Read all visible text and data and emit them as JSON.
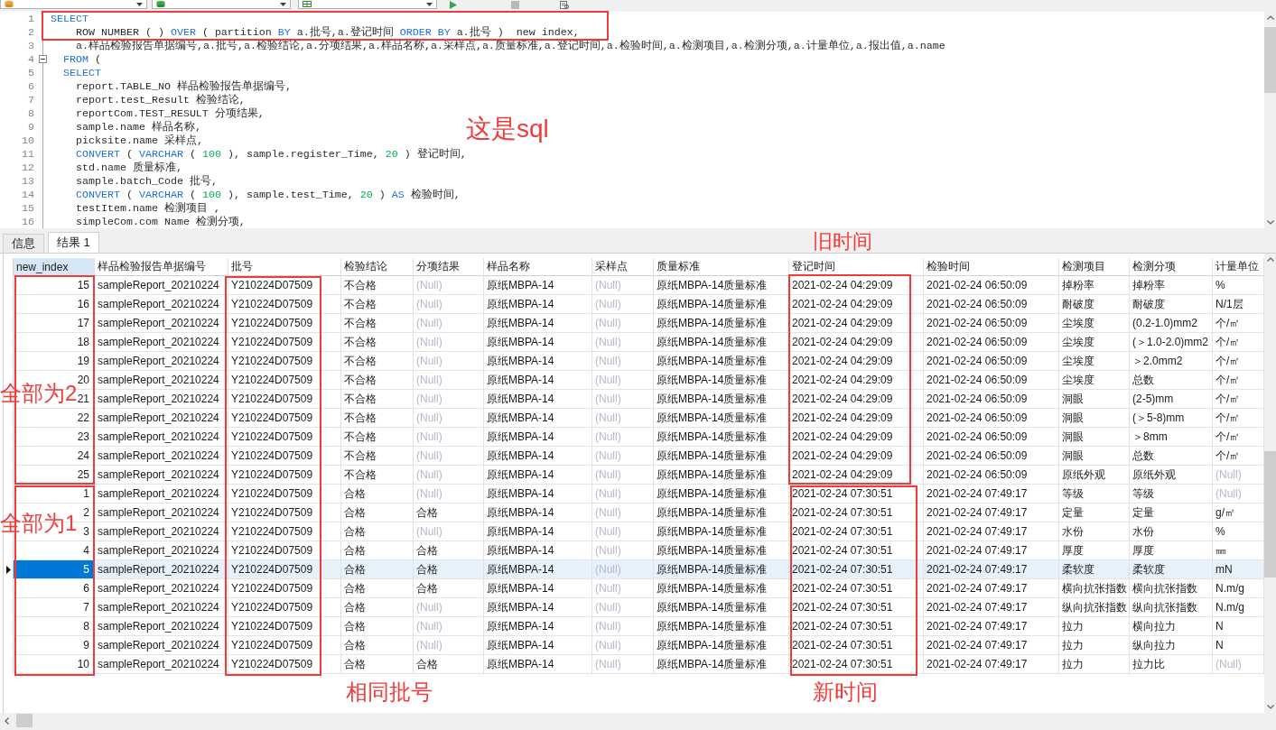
{
  "editor": {
    "lines": [
      {
        "number": "1",
        "fold_marker": false,
        "code": [
          {
            "kind": "keyword",
            "text": "SELECT"
          }
        ]
      },
      {
        "number": "2",
        "fold_marker": false,
        "code": [
          {
            "kind": "plain",
            "text": "    ROW NUMBER ( ) "
          },
          {
            "kind": "keyword",
            "text": "OVER"
          },
          {
            "kind": "plain",
            "text": " ( partition "
          },
          {
            "kind": "keyword",
            "text": "BY"
          },
          {
            "kind": "plain",
            "text": " a.批号,a.登记时间 "
          },
          {
            "kind": "keyword",
            "text": "ORDER BY"
          },
          {
            "kind": "plain",
            "text": " a.批号 )  new index,"
          }
        ]
      },
      {
        "number": "3",
        "fold_marker": false,
        "code": [
          {
            "kind": "plain",
            "text": "    a.样品检验报告单据编号,a.批号,a.检验结论,a.分项结果,a.样品名称,a.采样点,a.质量标准,a.登记时间,a.检验时间,a.检测项目,a.检测分项,a.计量单位,a.报出值,a.name"
          }
        ]
      },
      {
        "number": "4",
        "fold_marker": true,
        "code": [
          {
            "kind": "keyword",
            "text": "  FROM"
          },
          {
            "kind": "plain",
            "text": " ("
          }
        ]
      },
      {
        "number": "5",
        "fold_marker": false,
        "code": [
          {
            "kind": "keyword",
            "text": "  SELECT"
          }
        ]
      },
      {
        "number": "6",
        "fold_marker": false,
        "code": [
          {
            "kind": "plain",
            "text": "    report.TABLE_NO 样品检验报告单据编号,"
          }
        ]
      },
      {
        "number": "7",
        "fold_marker": false,
        "code": [
          {
            "kind": "plain",
            "text": "    report.test_Result 检验结论,"
          }
        ]
      },
      {
        "number": "8",
        "fold_marker": false,
        "code": [
          {
            "kind": "plain",
            "text": "    reportCom.TEST_RESULT 分项结果,"
          }
        ]
      },
      {
        "number": "9",
        "fold_marker": false,
        "code": [
          {
            "kind": "plain",
            "text": "    sample.name 样品名称,"
          }
        ]
      },
      {
        "number": "10",
        "fold_marker": false,
        "code": [
          {
            "kind": "plain",
            "text": "    picksite.name 采样点,"
          }
        ]
      },
      {
        "number": "11",
        "fold_marker": false,
        "code": [
          {
            "kind": "keyword",
            "text": "    CONVERT"
          },
          {
            "kind": "plain",
            "text": " ( "
          },
          {
            "kind": "keyword",
            "text": "VARCHAR"
          },
          {
            "kind": "plain",
            "text": " ( "
          },
          {
            "kind": "number",
            "text": "100"
          },
          {
            "kind": "plain",
            "text": " ), sample.register_Time, "
          },
          {
            "kind": "number",
            "text": "20"
          },
          {
            "kind": "plain",
            "text": " ) 登记时间,"
          }
        ]
      },
      {
        "number": "12",
        "fold_marker": false,
        "code": [
          {
            "kind": "plain",
            "text": "    std.name 质量标准,"
          }
        ]
      },
      {
        "number": "13",
        "fold_marker": false,
        "code": [
          {
            "kind": "plain",
            "text": "    sample.batch_Code 批号,"
          }
        ]
      },
      {
        "number": "14",
        "fold_marker": false,
        "code": [
          {
            "kind": "keyword",
            "text": "    CONVERT"
          },
          {
            "kind": "plain",
            "text": " ( "
          },
          {
            "kind": "keyword",
            "text": "VARCHAR"
          },
          {
            "kind": "plain",
            "text": " ( "
          },
          {
            "kind": "number",
            "text": "100"
          },
          {
            "kind": "plain",
            "text": " ), sample.test_Time, "
          },
          {
            "kind": "number",
            "text": "20"
          },
          {
            "kind": "plain",
            "text": " ) "
          },
          {
            "kind": "keyword",
            "text": "AS"
          },
          {
            "kind": "plain",
            "text": " 检验时间,"
          }
        ]
      },
      {
        "number": "15",
        "fold_marker": false,
        "code": [
          {
            "kind": "plain",
            "text": "    testItem.name 检测项目 ,"
          }
        ]
      },
      {
        "number": "16",
        "fold_marker": false,
        "code": [
          {
            "kind": "plain",
            "text": "    simpleCom.com Name 检测分项,"
          }
        ]
      }
    ],
    "annotations": [
      {
        "kind": "frame"
      },
      {
        "kind": "note",
        "text": "这是sql"
      }
    ]
  },
  "results": {
    "tabs": [
      {
        "label": "信息",
        "selected": false
      },
      {
        "label": "结果 1",
        "selected": true
      }
    ],
    "table": {
      "columns": [
        {
          "label": "new_index",
          "selected": true
        },
        {
          "label": "样品检验报告单据编号",
          "selected": false
        },
        {
          "label": "批号",
          "selected": false
        },
        {
          "label": "检验结论",
          "selected": false
        },
        {
          "label": "分项结果",
          "selected": false
        },
        {
          "label": "样品名称",
          "selected": false
        },
        {
          "label": "采样点",
          "selected": false
        },
        {
          "label": "质量标准",
          "selected": false
        },
        {
          "label": "登记时间",
          "selected": false
        },
        {
          "label": "检验时间",
          "selected": false
        },
        {
          "label": "检测项目",
          "selected": false
        },
        {
          "label": "检测分项",
          "selected": false
        },
        {
          "label": "计量单位",
          "selected": false
        }
      ],
      "rows": [
        {
          "selected": false,
          "cells": [
            "15",
            "sampleReport_20210224",
            "Y210224D07509",
            "不合格",
            {
              "kind": "null",
              "text": "(Null)"
            },
            "原纸MBPA-14",
            {
              "kind": "null",
              "text": "(Null)"
            },
            "原纸MBPA-14质量标准",
            "2021-02-24 04:29:09",
            "2021-02-24 06:50:09",
            "掉粉率",
            "掉粉率",
            "%"
          ]
        },
        {
          "selected": false,
          "cells": [
            "16",
            "sampleReport_20210224",
            "Y210224D07509",
            "不合格",
            {
              "kind": "null",
              "text": "(Null)"
            },
            "原纸MBPA-14",
            {
              "kind": "null",
              "text": "(Null)"
            },
            "原纸MBPA-14质量标准",
            "2021-02-24 04:29:09",
            "2021-02-24 06:50:09",
            "耐破度",
            "耐破度",
            "N/1层"
          ]
        },
        {
          "selected": false,
          "cells": [
            "17",
            "sampleReport_20210224",
            "Y210224D07509",
            "不合格",
            {
              "kind": "null",
              "text": "(Null)"
            },
            "原纸MBPA-14",
            {
              "kind": "null",
              "text": "(Null)"
            },
            "原纸MBPA-14质量标准",
            "2021-02-24 04:29:09",
            "2021-02-24 06:50:09",
            "尘埃度",
            "(0.2-1.0)mm2",
            "个/㎡"
          ]
        },
        {
          "selected": false,
          "cells": [
            "18",
            "sampleReport_20210224",
            "Y210224D07509",
            "不合格",
            {
              "kind": "null",
              "text": "(Null)"
            },
            "原纸MBPA-14",
            {
              "kind": "null",
              "text": "(Null)"
            },
            "原纸MBPA-14质量标准",
            "2021-02-24 04:29:09",
            "2021-02-24 06:50:09",
            "尘埃度",
            "(＞1.0-2.0)mm2",
            "个/㎡"
          ]
        },
        {
          "selected": false,
          "cells": [
            "19",
            "sampleReport_20210224",
            "Y210224D07509",
            "不合格",
            {
              "kind": "null",
              "text": "(Null)"
            },
            "原纸MBPA-14",
            {
              "kind": "null",
              "text": "(Null)"
            },
            "原纸MBPA-14质量标准",
            "2021-02-24 04:29:09",
            "2021-02-24 06:50:09",
            "尘埃度",
            "＞2.0mm2",
            "个/㎡"
          ]
        },
        {
          "selected": false,
          "cells": [
            "20",
            "sampleReport_20210224",
            "Y210224D07509",
            "不合格",
            {
              "kind": "null",
              "text": "(Null)"
            },
            "原纸MBPA-14",
            {
              "kind": "null",
              "text": "(Null)"
            },
            "原纸MBPA-14质量标准",
            "2021-02-24 04:29:09",
            "2021-02-24 06:50:09",
            "尘埃度",
            "总数",
            "个/㎡"
          ]
        },
        {
          "selected": false,
          "cells": [
            "21",
            "sampleReport_20210224",
            "Y210224D07509",
            "不合格",
            {
              "kind": "null",
              "text": "(Null)"
            },
            "原纸MBPA-14",
            {
              "kind": "null",
              "text": "(Null)"
            },
            "原纸MBPA-14质量标准",
            "2021-02-24 04:29:09",
            "2021-02-24 06:50:09",
            "洞眼",
            "(2-5)mm",
            "个/㎡"
          ]
        },
        {
          "selected": false,
          "cells": [
            "22",
            "sampleReport_20210224",
            "Y210224D07509",
            "不合格",
            {
              "kind": "null",
              "text": "(Null)"
            },
            "原纸MBPA-14",
            {
              "kind": "null",
              "text": "(Null)"
            },
            "原纸MBPA-14质量标准",
            "2021-02-24 04:29:09",
            "2021-02-24 06:50:09",
            "洞眼",
            "(＞5-8)mm",
            "个/㎡"
          ]
        },
        {
          "selected": false,
          "cells": [
            "23",
            "sampleReport_20210224",
            "Y210224D07509",
            "不合格",
            {
              "kind": "null",
              "text": "(Null)"
            },
            "原纸MBPA-14",
            {
              "kind": "null",
              "text": "(Null)"
            },
            "原纸MBPA-14质量标准",
            "2021-02-24 04:29:09",
            "2021-02-24 06:50:09",
            "洞眼",
            "＞8mm",
            "个/㎡"
          ]
        },
        {
          "selected": false,
          "cells": [
            "24",
            "sampleReport_20210224",
            "Y210224D07509",
            "不合格",
            {
              "kind": "null",
              "text": "(Null)"
            },
            "原纸MBPA-14",
            {
              "kind": "null",
              "text": "(Null)"
            },
            "原纸MBPA-14质量标准",
            "2021-02-24 04:29:09",
            "2021-02-24 06:50:09",
            "洞眼",
            "总数",
            "个/㎡"
          ]
        },
        {
          "selected": false,
          "cells": [
            "25",
            "sampleReport_20210224",
            "Y210224D07509",
            "不合格",
            {
              "kind": "null",
              "text": "(Null)"
            },
            "原纸MBPA-14",
            {
              "kind": "null",
              "text": "(Null)"
            },
            "原纸MBPA-14质量标准",
            "2021-02-24 04:29:09",
            "2021-02-24 06:50:09",
            "原纸外观",
            "原纸外观",
            {
              "kind": "null",
              "text": "(Null)"
            }
          ]
        },
        {
          "selected": false,
          "cells": [
            "1",
            "sampleReport_20210224",
            "Y210224D07509",
            "合格",
            {
              "kind": "null",
              "text": "(Null)"
            },
            "原纸MBPA-14",
            {
              "kind": "null",
              "text": "(Null)"
            },
            "原纸MBPA-14质量标准",
            "2021-02-24 07:30:51",
            "2021-02-24 07:49:17",
            "等级",
            "等级",
            {
              "kind": "null",
              "text": "(Null)"
            }
          ]
        },
        {
          "selected": false,
          "cells": [
            "2",
            "sampleReport_20210224",
            "Y210224D07509",
            "合格",
            "合格",
            "原纸MBPA-14",
            {
              "kind": "null",
              "text": "(Null)"
            },
            "原纸MBPA-14质量标准",
            "2021-02-24 07:30:51",
            "2021-02-24 07:49:17",
            "定量",
            "定量",
            "g/㎡"
          ]
        },
        {
          "selected": false,
          "cells": [
            "3",
            "sampleReport_20210224",
            "Y210224D07509",
            "合格",
            {
              "kind": "null",
              "text": "(Null)"
            },
            "原纸MBPA-14",
            {
              "kind": "null",
              "text": "(Null)"
            },
            "原纸MBPA-14质量标准",
            "2021-02-24 07:30:51",
            "2021-02-24 07:49:17",
            "水份",
            "水份",
            "%"
          ]
        },
        {
          "selected": false,
          "cells": [
            "4",
            "sampleReport_20210224",
            "Y210224D07509",
            "合格",
            "合格",
            "原纸MBPA-14",
            {
              "kind": "null",
              "text": "(Null)"
            },
            "原纸MBPA-14质量标准",
            "2021-02-24 07:30:51",
            "2021-02-24 07:49:17",
            "厚度",
            "厚度",
            "㎜"
          ]
        },
        {
          "selected": true,
          "cells": [
            "5",
            "sampleReport_20210224",
            "Y210224D07509",
            "合格",
            "合格",
            "原纸MBPA-14",
            {
              "kind": "null",
              "text": "(Null)"
            },
            "原纸MBPA-14质量标准",
            "2021-02-24 07:30:51",
            "2021-02-24 07:49:17",
            "柔软度",
            "柔软度",
            "mN"
          ]
        },
        {
          "selected": false,
          "cells": [
            "6",
            "sampleReport_20210224",
            "Y210224D07509",
            "合格",
            "合格",
            "原纸MBPA-14",
            {
              "kind": "null",
              "text": "(Null)"
            },
            "原纸MBPA-14质量标准",
            "2021-02-24 07:30:51",
            "2021-02-24 07:49:17",
            "横向抗张指数",
            "横向抗张指数",
            "N.m/g"
          ]
        },
        {
          "selected": false,
          "cells": [
            "7",
            "sampleReport_20210224",
            "Y210224D07509",
            "合格",
            {
              "kind": "null",
              "text": "(Null)"
            },
            "原纸MBPA-14",
            {
              "kind": "null",
              "text": "(Null)"
            },
            "原纸MBPA-14质量标准",
            "2021-02-24 07:30:51",
            "2021-02-24 07:49:17",
            "纵向抗张指数",
            "纵向抗张指数",
            "N.m/g"
          ]
        },
        {
          "selected": false,
          "cells": [
            "8",
            "sampleReport_20210224",
            "Y210224D07509",
            "合格",
            {
              "kind": "null",
              "text": "(Null)"
            },
            "原纸MBPA-14",
            {
              "kind": "null",
              "text": "(Null)"
            },
            "原纸MBPA-14质量标准",
            "2021-02-24 07:30:51",
            "2021-02-24 07:49:17",
            "拉力",
            "横向拉力",
            "N"
          ]
        },
        {
          "selected": false,
          "cells": [
            "9",
            "sampleReport_20210224",
            "Y210224D07509",
            "合格",
            {
              "kind": "null",
              "text": "(Null)"
            },
            "原纸MBPA-14",
            {
              "kind": "null",
              "text": "(Null)"
            },
            "原纸MBPA-14质量标准",
            "2021-02-24 07:30:51",
            "2021-02-24 07:49:17",
            "拉力",
            "纵向拉力",
            "N"
          ]
        },
        {
          "selected": false,
          "cells": [
            "10",
            "sampleReport_20210224",
            "Y210224D07509",
            "合格",
            "合格",
            "原纸MBPA-14",
            {
              "kind": "null",
              "text": "(Null)"
            },
            "原纸MBPA-14质量标准",
            "2021-02-24 07:30:51",
            "2021-02-24 07:49:17",
            "拉力",
            "拉力比",
            {
              "kind": "null",
              "text": "(Null)"
            }
          ]
        }
      ]
    },
    "annotations": [
      {
        "kind": "frame"
      },
      {
        "kind": "note",
        "text": "全部为2"
      },
      {
        "kind": "frame"
      },
      {
        "kind": "note",
        "text": "相同批号"
      },
      {
        "kind": "frame"
      },
      {
        "kind": "note",
        "text": "旧时间"
      },
      {
        "kind": "frame"
      },
      {
        "kind": "note",
        "text": "全部为1"
      },
      {
        "kind": "frame"
      },
      {
        "kind": "note",
        "text": "新时间"
      }
    ]
  }
}
